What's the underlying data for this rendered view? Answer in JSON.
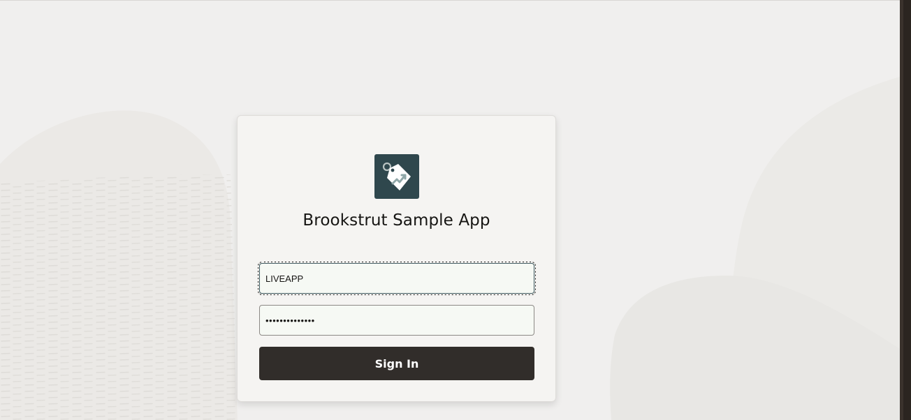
{
  "app": {
    "title": "Brookstrut Sample App",
    "logo_icon": "price-tag-trend-icon",
    "logo_bg": "#2f474d"
  },
  "login": {
    "username_value": "LIVEAPP",
    "password_value": "••••••••••••••",
    "signin_label": "Sign In",
    "signin_bg": "#312d2a"
  },
  "theme": {
    "page_bg": "#f0efee",
    "card_bg": "#f5f4f2"
  }
}
